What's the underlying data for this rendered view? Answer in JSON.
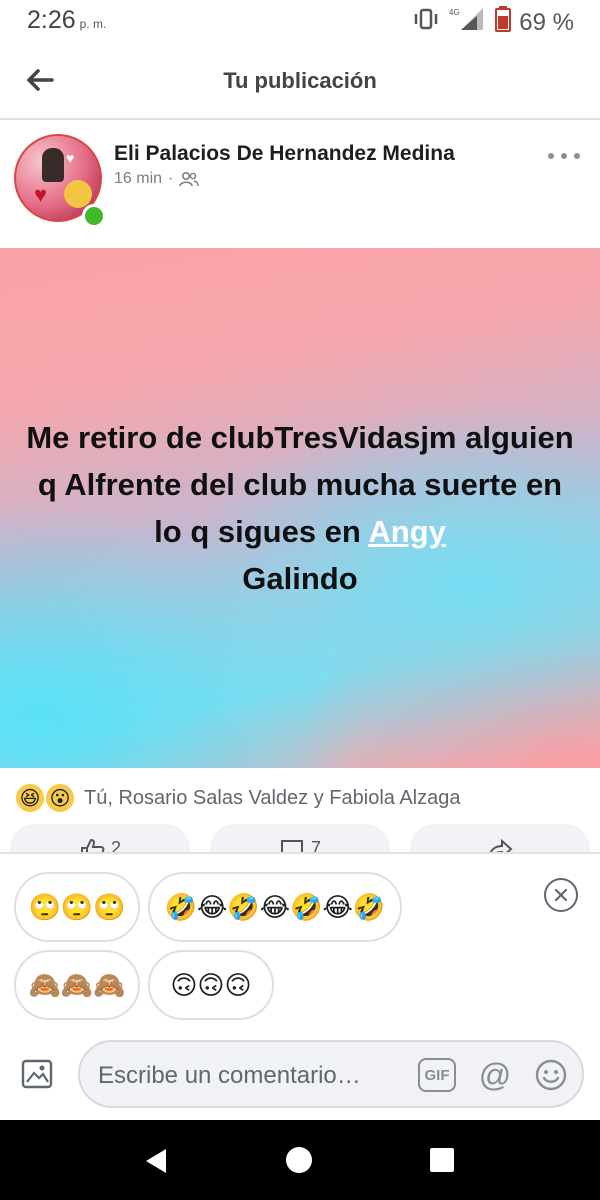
{
  "status_bar": {
    "time": "2:26",
    "ampm": "p. m.",
    "network": "4G",
    "battery_percent": "69 %",
    "icons": [
      "vibrate-icon",
      "signal-icon",
      "battery-icon"
    ]
  },
  "header": {
    "title": "Tu publicación",
    "back_icon": "arrow-left-icon"
  },
  "post": {
    "author": "Eli Palacios De Hernandez Medina",
    "time_ago": "16 min",
    "separator": "·",
    "audience_icon": "friends-icon",
    "text_before_mention": "Me retiro de clubTresVidasjm alguien q Alfrente del club mucha suerte en lo q sigues en ",
    "mention_first": "Angy",
    "text_after_mention": "Galindo",
    "background_colors": [
      "#f9a2a7",
      "#86dbee",
      "#f7a9ae"
    ]
  },
  "reactions": {
    "emojis": [
      "😆",
      "😮"
    ],
    "names": "Tú, Rosario Salas Valdez y Fabiola Alzaga"
  },
  "actions": {
    "like_count": "2",
    "comment_count": "7"
  },
  "stickers": {
    "chips": [
      "🙄🙄🙄",
      "🤣😂🤣😂🤣😂🤣",
      "🙈🙈🙈",
      "🙃🙃🙃"
    ]
  },
  "composer": {
    "placeholder": "Escribe un comentario…",
    "gif_label": "GIF",
    "at_label": "@"
  }
}
